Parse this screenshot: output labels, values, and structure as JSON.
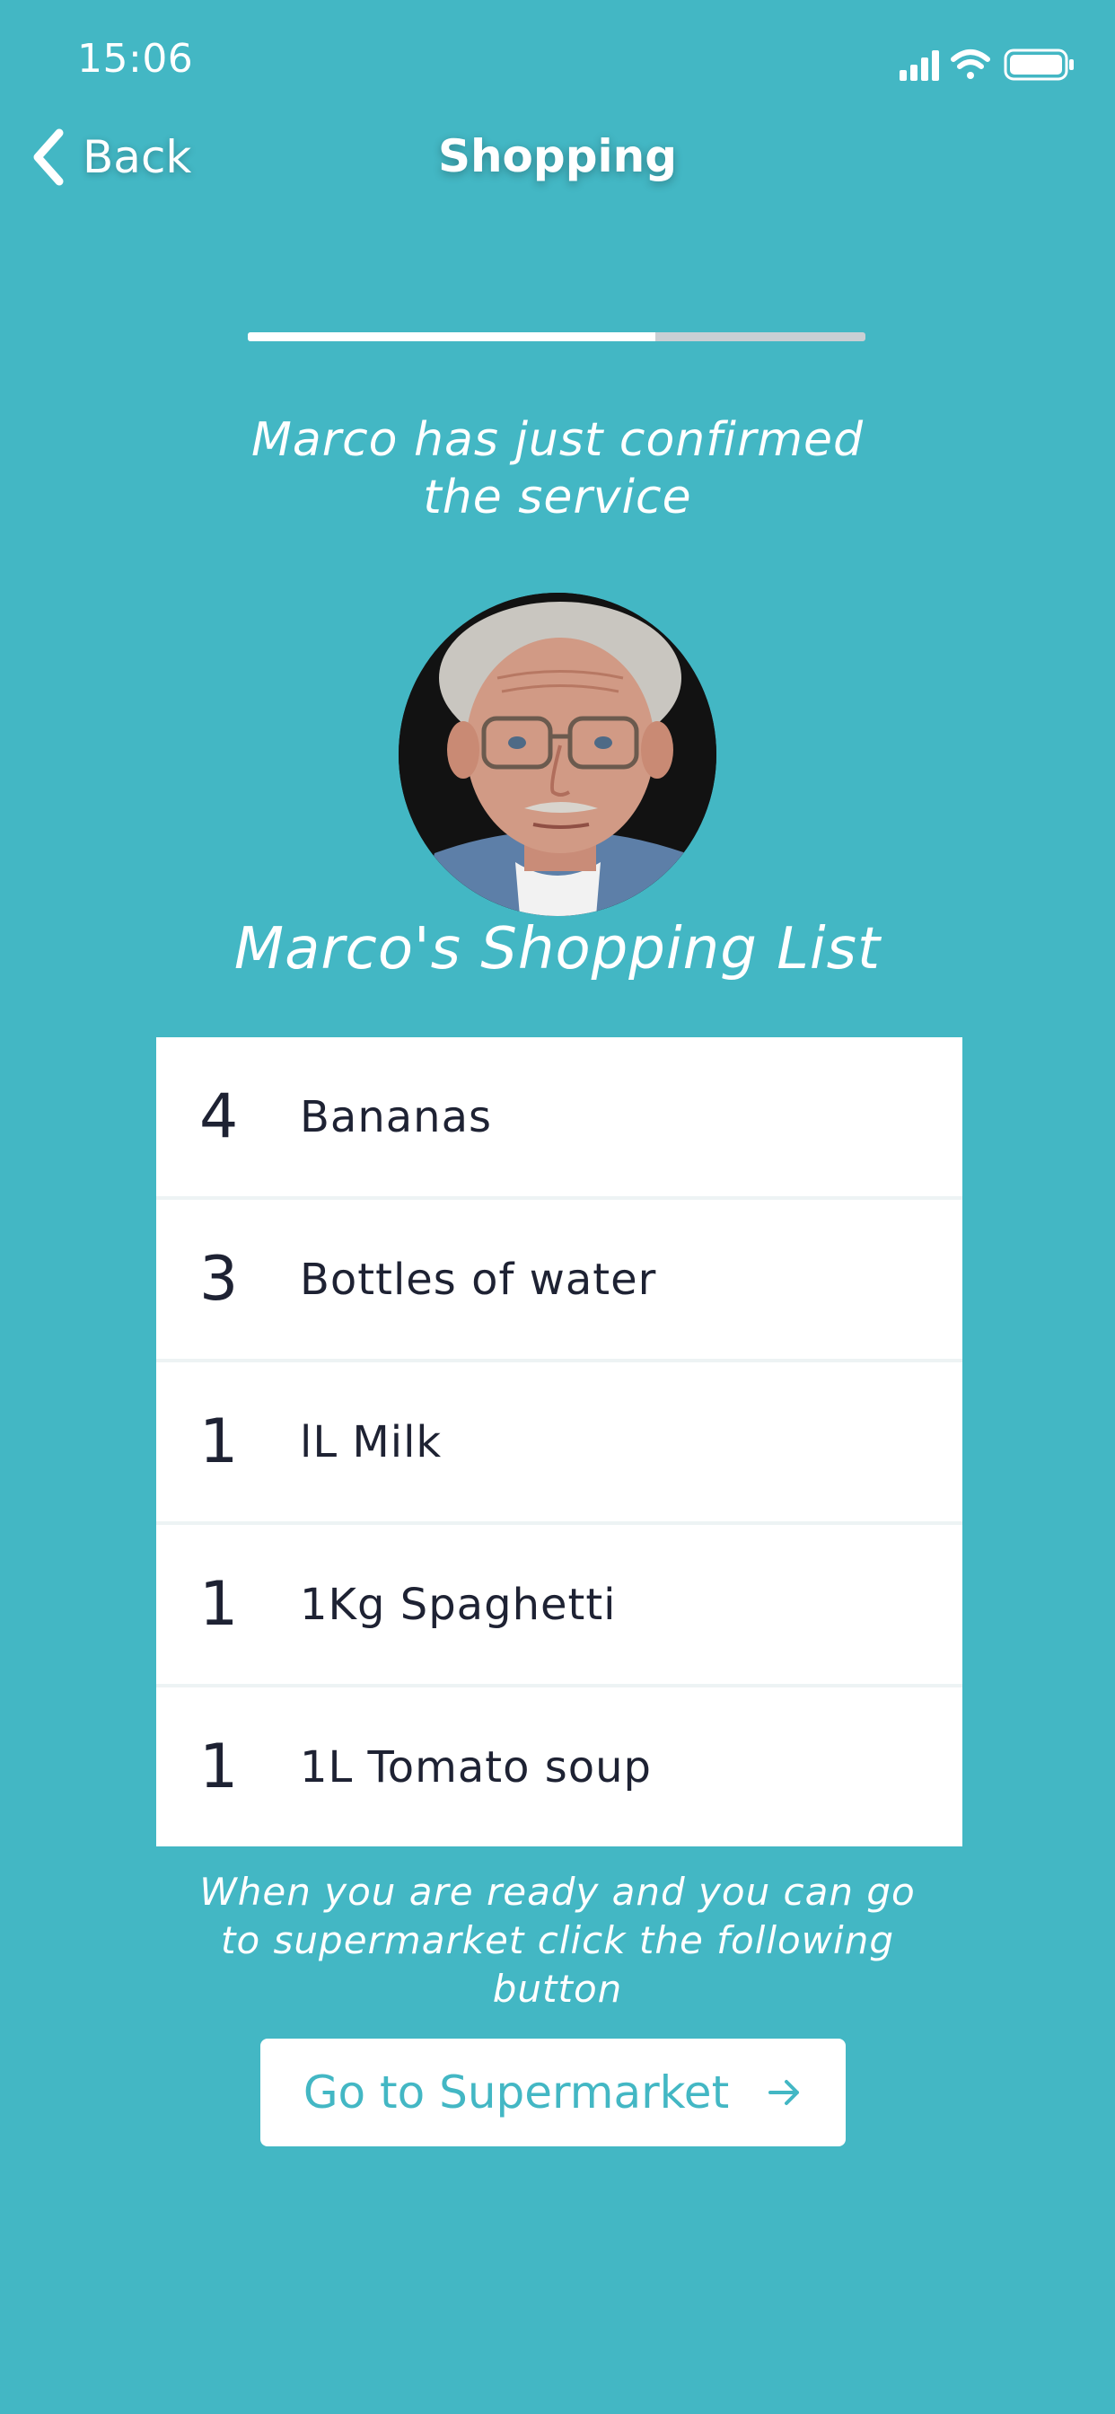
{
  "status_bar": {
    "time": "15:06",
    "icons": [
      "cellular-signal-icon",
      "wifi-icon",
      "battery-icon"
    ]
  },
  "nav": {
    "back_label": "Back",
    "back_icon": "chevron-left-icon",
    "title": "Shopping"
  },
  "progress": {
    "fraction": 0.66
  },
  "confirmation": {
    "line1": "Marco has just confirmed",
    "line2": "the service"
  },
  "shopping_list": {
    "title": "Marco's Shopping List",
    "items": [
      {
        "qty": "4",
        "name": "Bananas"
      },
      {
        "qty": "3",
        "name": "Bottles of water"
      },
      {
        "qty": "1",
        "name": "lL Milk"
      },
      {
        "qty": "1",
        "name": "1Kg Spaghetti"
      },
      {
        "qty": "1",
        "name": "1L Tomato soup"
      }
    ]
  },
  "instructions": {
    "line1": "When you are ready and you can go",
    "line2": "to supermarket click the following",
    "line3": "button"
  },
  "cta": {
    "label": "Go to Supermarket",
    "icon": "arrow-right-icon"
  },
  "colors": {
    "background": "#43b7c4",
    "accent": "#43b7c4",
    "text_dark": "#1e2233",
    "progress_track": "#c9cfd4",
    "white": "#ffffff"
  }
}
